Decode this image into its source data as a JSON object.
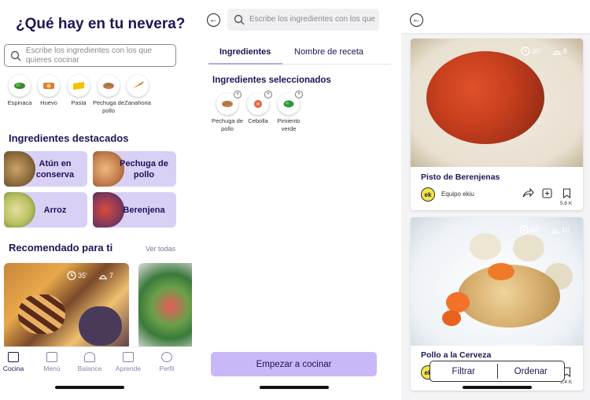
{
  "screen1": {
    "title": "¿Qué hay en tu nevera?",
    "search_placeholder": "Escribe los ingredientes con los que quieres cocinar",
    "chips": [
      {
        "label": "Espinaca",
        "icon": "spinach-icon",
        "color": "#3a8a2e"
      },
      {
        "label": "Huevo",
        "icon": "egg-icon",
        "color": "#e07a3c"
      },
      {
        "label": "Pasta",
        "icon": "pasta-icon",
        "color": "#f2c200"
      },
      {
        "label": "Pechuga de pollo",
        "icon": "chicken-breast-icon",
        "color": "#e06a4a"
      },
      {
        "label": "Zanahoria",
        "icon": "carrot-icon",
        "color": "#f08a1c"
      }
    ],
    "featured_title": "Ingredientes destacados",
    "featured": [
      {
        "label": "Atún en conserva",
        "icon": "tuna-icon"
      },
      {
        "label": "Pechuga de pollo",
        "icon": "chicken-breast-icon"
      },
      {
        "label": "Arroz",
        "icon": "rice-icon"
      },
      {
        "label": "Berenjena",
        "icon": "eggplant-icon"
      }
    ],
    "recommended_title": "Recomendado para ti",
    "see_all": "Ver todas",
    "rec_card": {
      "time": "35'",
      "servings": "7"
    },
    "tabbar": [
      "Cocina",
      "Menú",
      "Balance",
      "Aprende",
      "Perfil"
    ]
  },
  "screen2": {
    "search_placeholder": "Escribe los ingredientes con los que c",
    "tabs": [
      "Ingredientes",
      "Nombre de receta"
    ],
    "selected_title": "Ingredientes seleccionados",
    "selected": [
      {
        "label": "Pechuga de pollo",
        "icon": "chicken-breast-icon"
      },
      {
        "label": "Cebolla",
        "icon": "onion-icon"
      },
      {
        "label": "Pimiento verde",
        "icon": "green-pepper-icon"
      }
    ],
    "start_button": "Empezar a cocinar"
  },
  "screen3": {
    "recipes": [
      {
        "title": "Pisto de Berenjenas",
        "time": "30'",
        "servings": "8",
        "author": "Equipo ekiu",
        "saves": "5.6 K"
      },
      {
        "title": "Pollo a la Cerveza",
        "time": "60'",
        "servings": "10",
        "author": "Equipo ekiu",
        "saves": "5.4 K"
      }
    ],
    "author_logo": "ek",
    "filter_label": "Filtrar",
    "order_label": "Ordenar"
  },
  "colors": {
    "accent": "#c9b8f7",
    "feature_bg": "#d8d0f5",
    "title": "#1f1457",
    "tab_active": "#b8a5f0"
  }
}
